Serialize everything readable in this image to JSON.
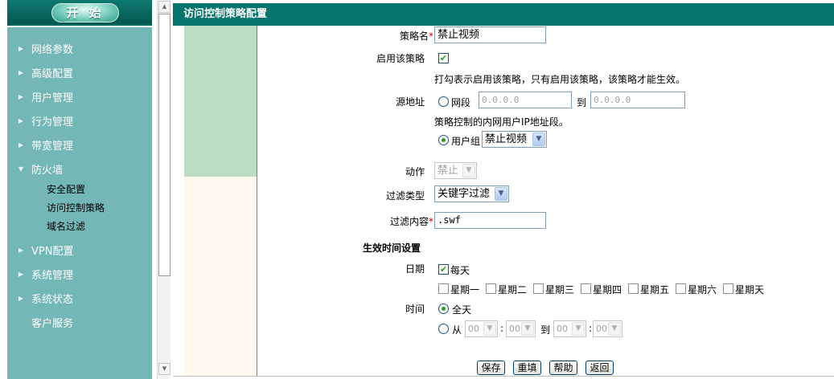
{
  "sidebar": {
    "start_label": "开 始",
    "menu": [
      {
        "label": "网络参数"
      },
      {
        "label": "高级配置"
      },
      {
        "label": "用户管理"
      },
      {
        "label": "行为管理"
      },
      {
        "label": "带宽管理"
      },
      {
        "label": "防火墙"
      },
      {
        "label": "VPN配置"
      },
      {
        "label": "系统管理"
      },
      {
        "label": "系统状态"
      },
      {
        "label": "客户服务"
      }
    ],
    "firewall_sub": [
      "安全配置",
      "访问控制策略",
      "域名过滤"
    ]
  },
  "title": "访问控制策略配置",
  "form": {
    "policy_name_label": "策略名",
    "policy_name_value": "禁止视频",
    "enable_label": "启用该策略",
    "enable_hint": "打勾表示启用该策略，只有启用该策略，该策略才能生效。",
    "source_label": "源地址",
    "segment_label": "网段",
    "ip_start": "0.0.0.0",
    "to_label": "到",
    "ip_end": "0.0.0.0",
    "source_hint": "策略控制的内网用户IP地址段。",
    "group_label": "用户组",
    "group_value": "禁止视频",
    "action_label": "动作",
    "action_value": "禁止",
    "filter_type_label": "过滤类型",
    "filter_type_value": "关键字过滤",
    "filter_content_label": "过滤内容",
    "filter_content_value": ".swf",
    "time_section": "生效时间设置",
    "date_label": "日期",
    "everyday_label": "每天",
    "weekdays": [
      "星期一",
      "星期二",
      "星期三",
      "星期四",
      "星期五",
      "星期六",
      "星期天"
    ],
    "time_label": "时间",
    "allday_label": "全天",
    "from_label": "从",
    "to2_label": "到",
    "colon": ":",
    "time_values": [
      "00",
      "00",
      "00",
      "00"
    ]
  },
  "buttons": {
    "save": "保存",
    "reset": "重填",
    "help": "帮助",
    "back": "返回"
  }
}
